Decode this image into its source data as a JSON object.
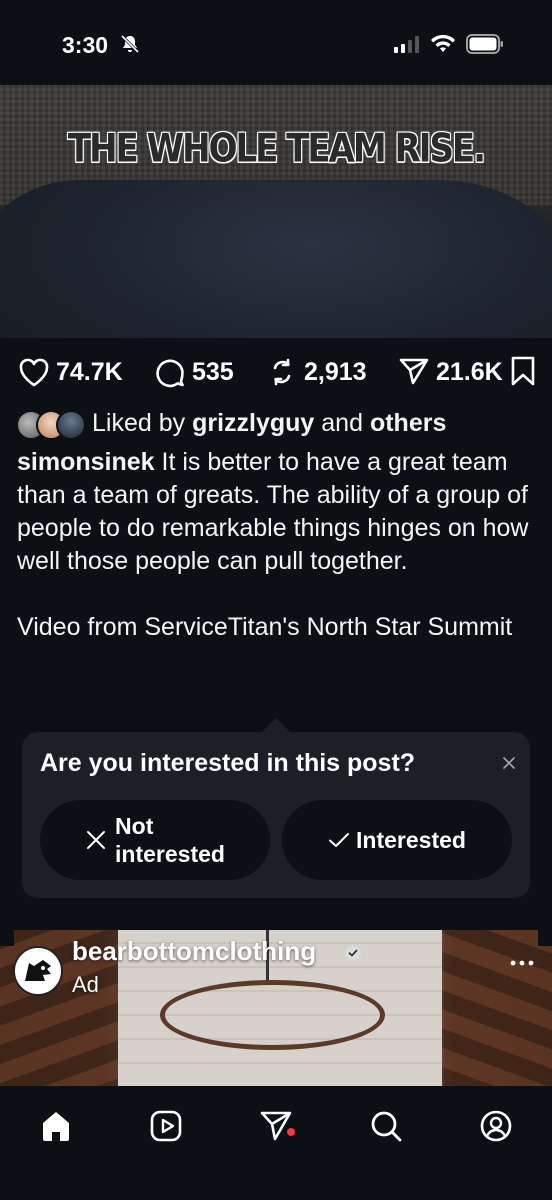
{
  "status_bar": {
    "time": "3:30"
  },
  "video": {
    "overlay_text": "THE WHOLE TEAM RISE."
  },
  "actions": {
    "likes": "74.7K",
    "comments": "535",
    "reposts": "2,913",
    "shares": "21.6K"
  },
  "liked_by": {
    "prefix": "Liked by",
    "user": "grizzlyguy",
    "conjunction": "and",
    "others": "others"
  },
  "caption": {
    "author": "simonsinek",
    "text": "It is better to have a great team than a team of greats. The ability of a group of people to do remarkable things hinges on how well those people can pull together.",
    "footer": "Video from ServiceTitan's North Star Summit"
  },
  "interest_prompt": {
    "title": "Are you interested in this post?",
    "not_interested_label_line1": "Not",
    "not_interested_label_line2": "interested",
    "interested_label": "Interested"
  },
  "ad": {
    "account": "bearbottomclothing",
    "label": "Ad"
  },
  "nav": {
    "items": [
      "home-icon",
      "reels-icon",
      "messages-icon",
      "search-icon",
      "profile-icon"
    ]
  },
  "colors": {
    "background": "#0c1014",
    "card": "#1c2026",
    "notification_dot": "#ff3040"
  }
}
